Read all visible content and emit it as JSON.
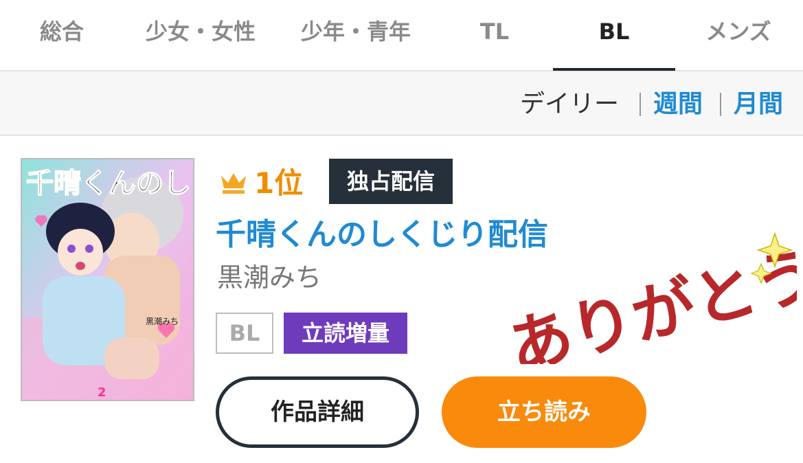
{
  "tabs": [
    {
      "label": "総合"
    },
    {
      "label": "少女・女性"
    },
    {
      "label": "少年・青年"
    },
    {
      "label": "TL"
    },
    {
      "label": "BL"
    },
    {
      "label": "メンズ"
    }
  ],
  "active_tab": "BL",
  "period": {
    "daily": "デイリー",
    "separator": "|",
    "weekly": "週間",
    "monthly": "月間"
  },
  "item": {
    "rank": "1位",
    "exclusive_badge": "独占配信",
    "title": "千晴くんのしくじり配信",
    "author": "黒潮みち",
    "genre_tag": "BL",
    "trial_tag": "立読増量",
    "detail_button": "作品詳細",
    "read_button": "立ち読み",
    "cover": {
      "title_art": "千晴くんのしくじり配信",
      "author_art": "黒潮みち",
      "volume": "2"
    }
  },
  "stamp": {
    "text": "ありがとう"
  },
  "colors": {
    "accent_blue": "#1f8ad2",
    "rank_orange": "#f08c00",
    "read_button": "#f98a0b",
    "exclusive_bg": "#25303a",
    "trial_tag_bg": "#6f3bbd",
    "stamp_red": "#b8282a"
  },
  "icons": {
    "rank": "crown-icon",
    "sparkle": "sparkle-icon"
  }
}
